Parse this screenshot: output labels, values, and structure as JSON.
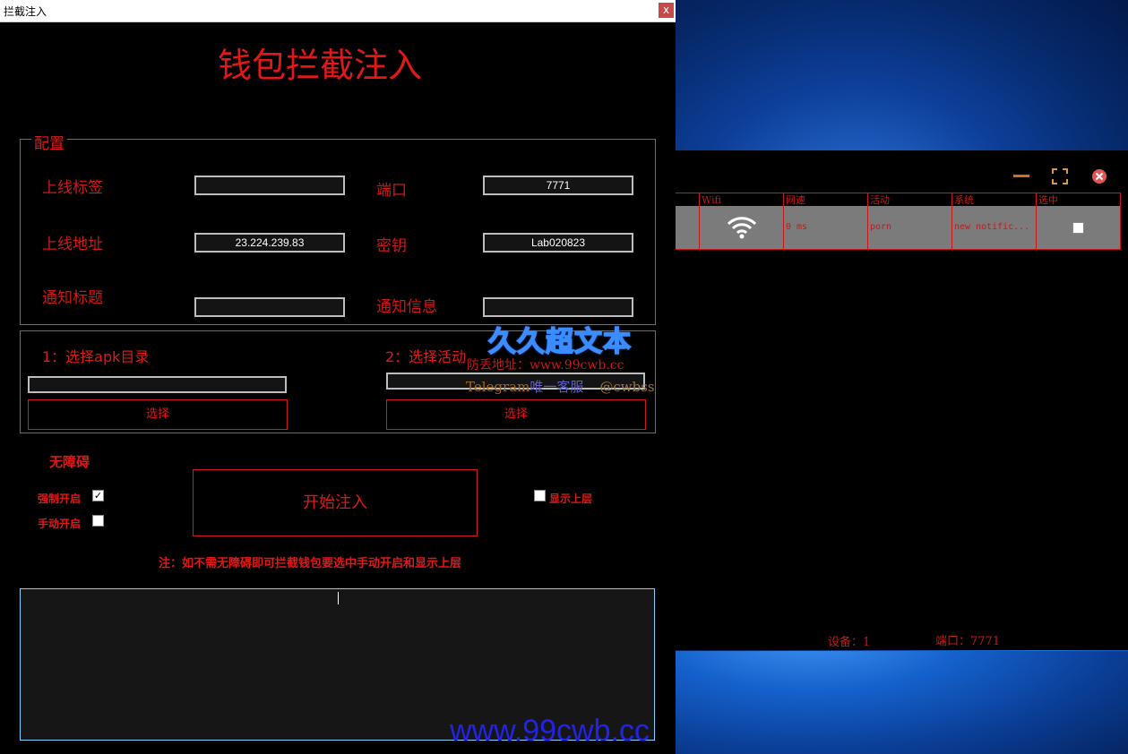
{
  "window": {
    "title": "拦截注入",
    "close_label": "x"
  },
  "app_title": "钱包拦截注入",
  "config": {
    "legend": "配置",
    "online_tag_label": "上线标签",
    "online_tag_value": "",
    "port_label": "端口",
    "port_value": "7771",
    "online_addr_label": "上线地址",
    "online_addr_value": "23.224.239.83",
    "secret_label": "密钥",
    "secret_value": "Lab020823",
    "notify_title_label": "通知标题",
    "notify_title_value": "",
    "notify_info_label": "通知信息",
    "notify_info_value": ""
  },
  "selection": {
    "apk_label": "1：选择apk目录",
    "apk_value": "",
    "apk_button": "选择",
    "activity_label": "2：选择活动",
    "activity_value": "",
    "activity_button": "选择"
  },
  "accessibility": {
    "heading": "无障碍",
    "force_label": "强制开启",
    "force_checked": true,
    "manual_label": "手动开启",
    "manual_checked": false,
    "show_top_label": "显示上层",
    "show_top_checked": false,
    "start_button": "开始注入",
    "note": "注：如不需无障碍即可拦截钱包要选中手动开启和显示上层"
  },
  "log": {
    "value": ""
  },
  "watermark": {
    "main": "久久超文本",
    "address": "防丢地址：www.99cwb.cc",
    "telegram_prefix": "Telegram",
    "telegram_mid": "唯一客服",
    "telegram_handle": "@cwbss",
    "bottom": "www.99cwb.cc"
  },
  "device_panel": {
    "icons": [
      "minimize-icon",
      "maximize-icon",
      "close-icon"
    ],
    "columns": [
      "Wifi",
      "网速",
      "活动",
      "系统",
      "选中"
    ],
    "rows": [
      {
        "wifi": "wifi-icon",
        "speed": "0 ms",
        "activity": "porn",
        "system": "new notific...",
        "selected": false
      }
    ],
    "device_count": "设备：1",
    "port": "端口：7771"
  }
}
